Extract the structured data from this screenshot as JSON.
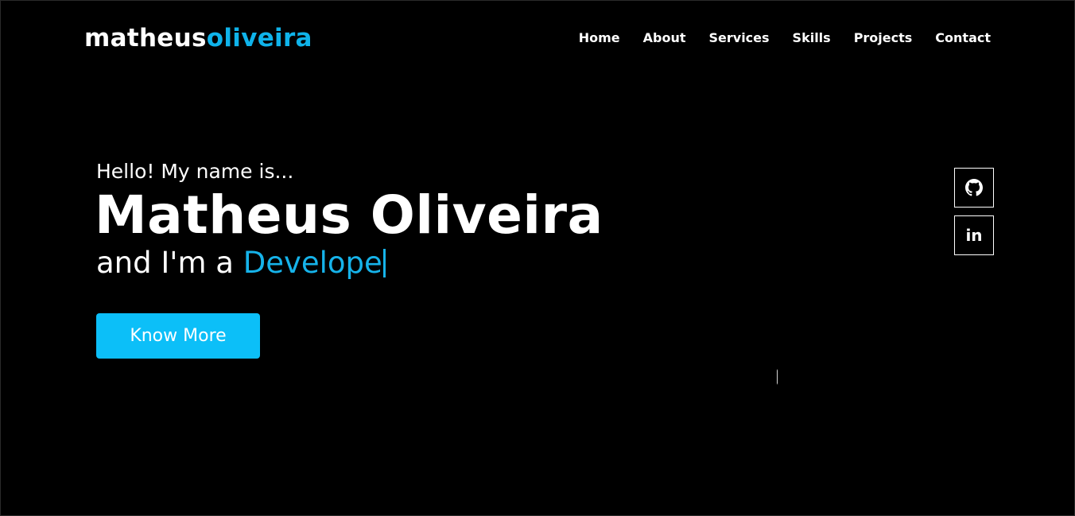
{
  "logo": {
    "part1": "matheus",
    "part2": "oliveira"
  },
  "nav": {
    "items": [
      {
        "label": "Home"
      },
      {
        "label": "About"
      },
      {
        "label": "Services"
      },
      {
        "label": "Skills"
      },
      {
        "label": "Projects"
      },
      {
        "label": "Contact"
      }
    ]
  },
  "hero": {
    "greeting": "Hello! My name is...",
    "name": "Matheus Oliveira",
    "role_prefix": "and I'm a ",
    "role_typed": "Develope",
    "cta_label": "Know More"
  },
  "social": {
    "items": [
      {
        "icon": "github-icon"
      },
      {
        "icon": "linkedin-icon",
        "glyph": "in"
      }
    ]
  },
  "colors": {
    "background": "#000000",
    "accent": "#0fb3ea",
    "button": "#0cbff8",
    "text": "#ffffff"
  }
}
